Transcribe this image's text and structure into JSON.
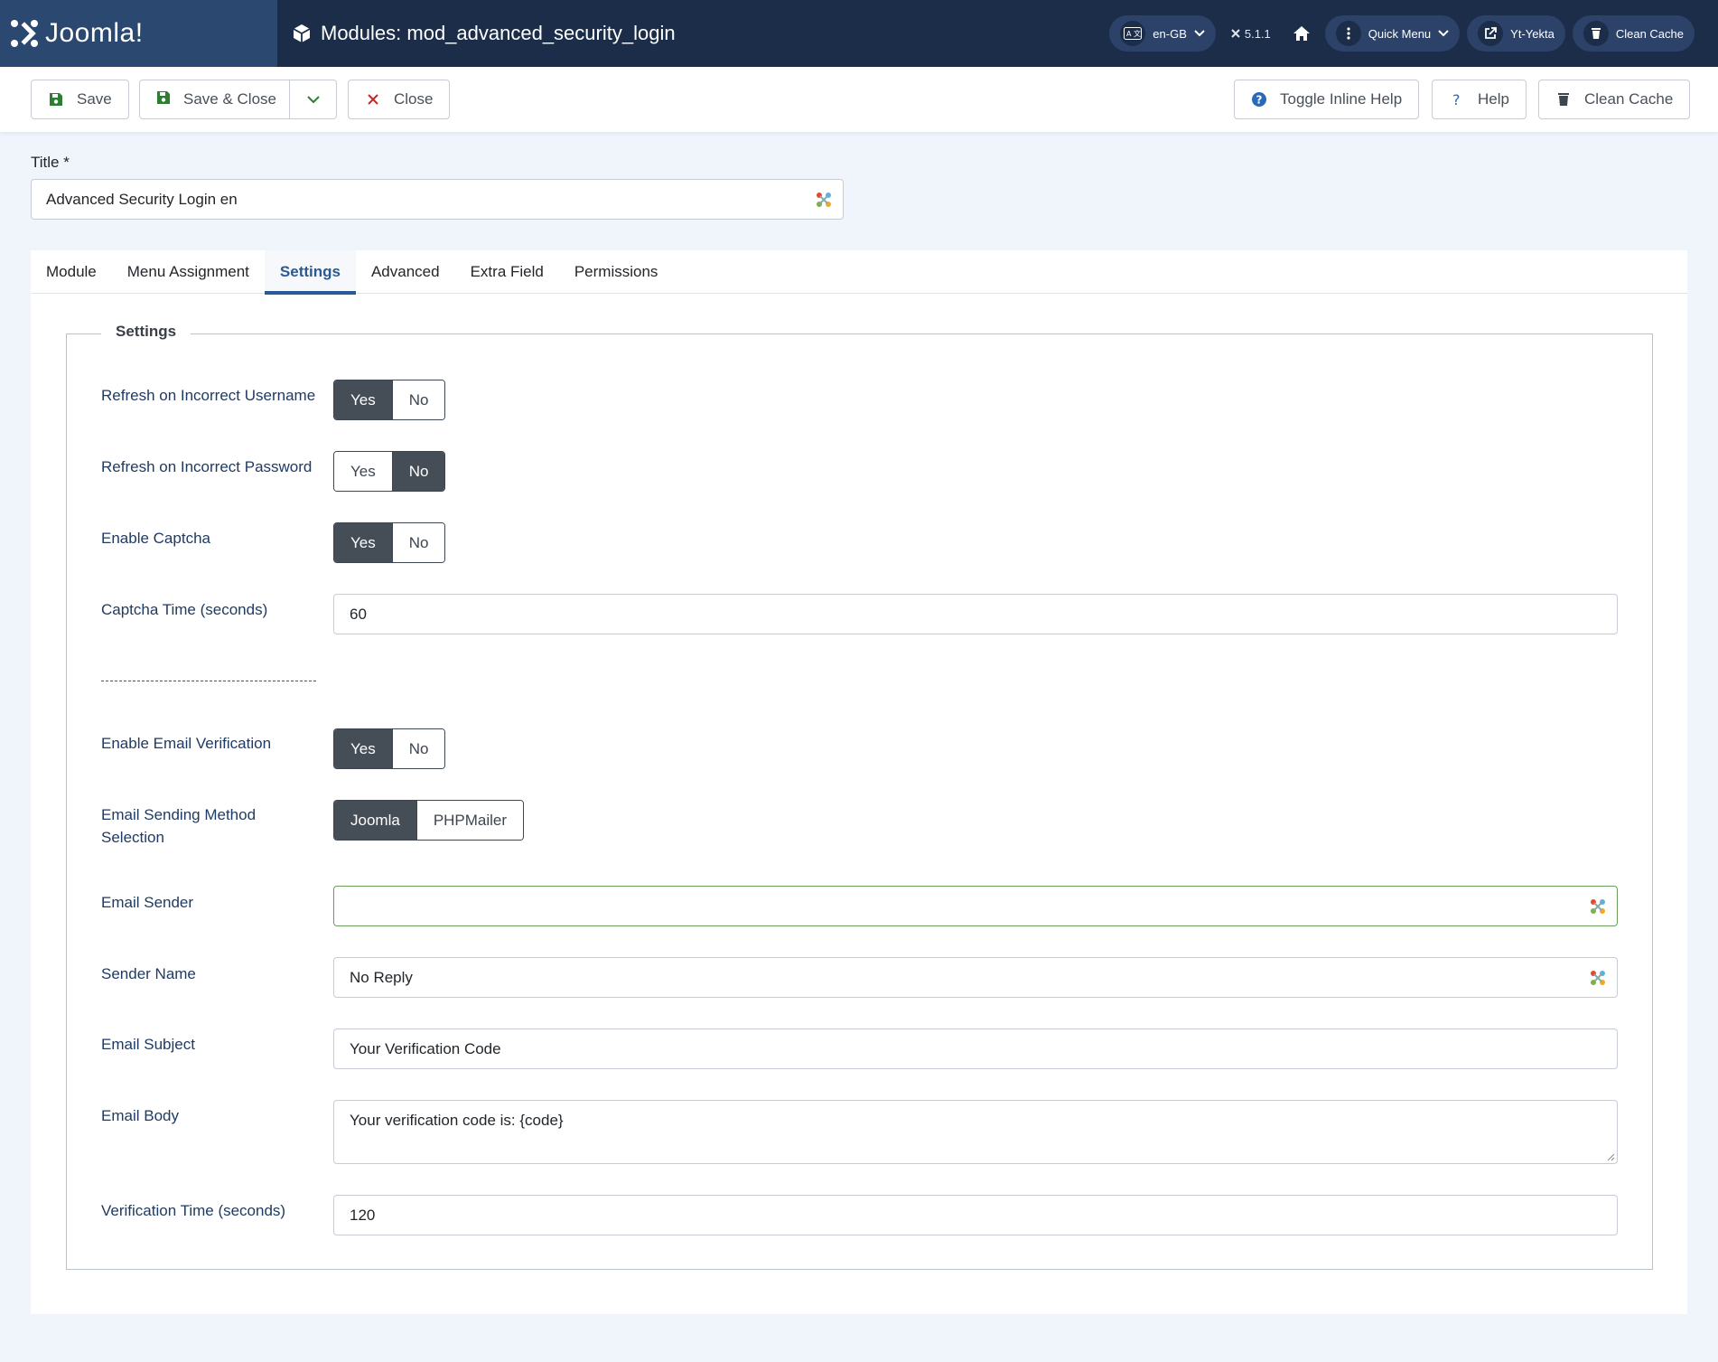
{
  "header": {
    "brand": "Joomla!",
    "title": "Modules: mod_advanced_security_login",
    "language": "en-GB",
    "version": "5.1.1",
    "quick_menu": "Quick Menu",
    "site": "Yt-Yekta",
    "clean_cache": "Clean Cache"
  },
  "toolbar": {
    "save": "Save",
    "save_close": "Save & Close",
    "close": "Close",
    "toggle_help": "Toggle Inline Help",
    "help": "Help",
    "clean_cache": "Clean Cache"
  },
  "form": {
    "title_label": "Title *",
    "title_value": "Advanced Security Login en"
  },
  "tabs": [
    "Module",
    "Menu Assignment",
    "Settings",
    "Advanced",
    "Extra Field",
    "Permissions"
  ],
  "settings": {
    "legend": "Settings",
    "yes": "Yes",
    "no": "No",
    "refresh_username_label": "Refresh on Incorrect Username",
    "refresh_username_value": "Yes",
    "refresh_password_label": "Refresh on Incorrect Password",
    "refresh_password_value": "No",
    "enable_captcha_label": "Enable Captcha",
    "enable_captcha_value": "Yes",
    "captcha_time_label": "Captcha Time (seconds)",
    "captcha_time_value": "60",
    "divider": "--------------------------------------------------------",
    "email_verification_label": "Enable Email Verification",
    "email_verification_value": "Yes",
    "sending_method_label": "Email Sending Method Selection",
    "method_joomla": "Joomla",
    "method_phpmailer": "PHPMailer",
    "sending_method_value": "Joomla",
    "email_sender_label": "Email Sender",
    "email_sender_value": "",
    "sender_name_label": "Sender Name",
    "sender_name_value": "No Reply",
    "email_subject_label": "Email Subject",
    "email_subject_value": "Your Verification Code",
    "email_body_label": "Email Body",
    "email_body_value": "Your verification code is: {code}",
    "verification_time_label": "Verification Time (seconds)",
    "verification_time_value": "120"
  },
  "colors": {
    "header_bg": "#1c2d4a",
    "brand_bg": "#2b4870",
    "accent": "#2a5a96",
    "toggle_on": "#454d57"
  }
}
